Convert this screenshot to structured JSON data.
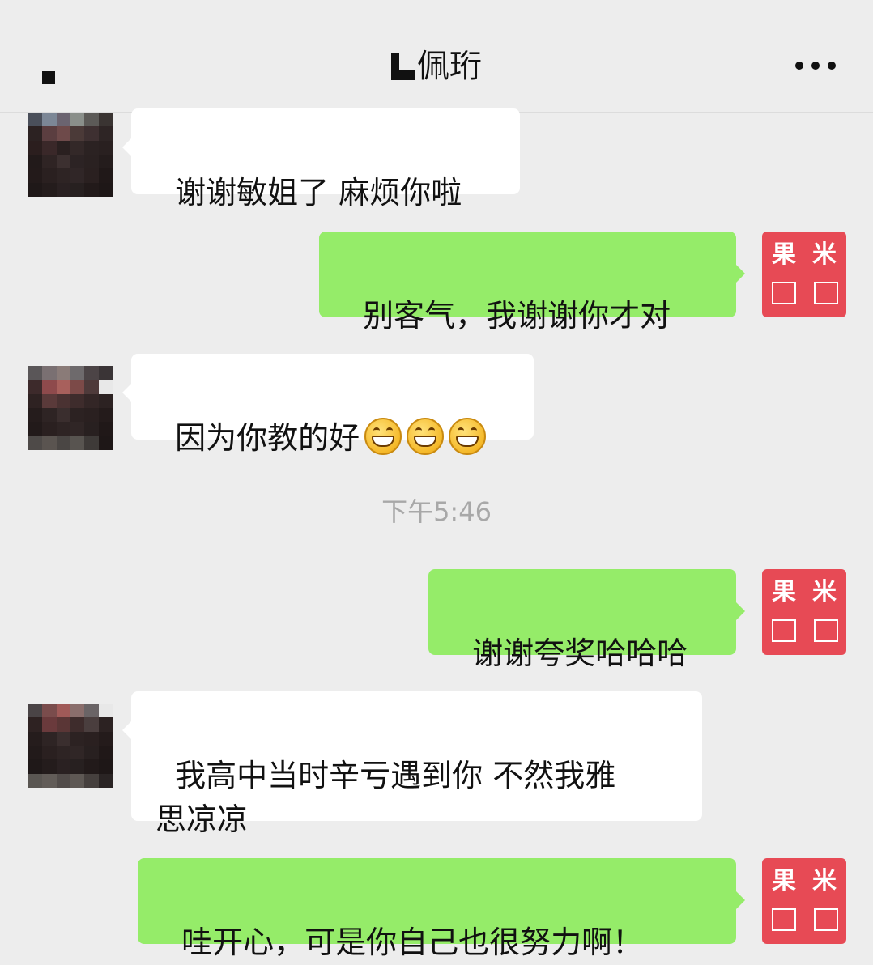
{
  "header": {
    "title": "佩珩",
    "back_icon": "back-icon",
    "more_icon": "more-dots-icon"
  },
  "colors": {
    "background": "#ededed",
    "incoming_bubble": "#ffffff",
    "outgoing_bubble": "#95ec69",
    "self_avatar": "#e74a55",
    "timestamp_text": "#a8a8a8"
  },
  "timestamp": "下午5:46",
  "self_avatar": {
    "glyph_top_left": "果",
    "glyph_top_right": "米"
  },
  "messages": [
    {
      "direction": "incoming",
      "text": "谢谢敏姐了 麻烦你啦"
    },
    {
      "direction": "outgoing",
      "text": "别客气，我谢谢你才对"
    },
    {
      "direction": "incoming",
      "text": "因为你教的好",
      "emoji": [
        "grin-emoji",
        "grin-emoji",
        "grin-emoji"
      ]
    },
    {
      "direction": "outgoing",
      "text": "谢谢夸奖哈哈哈"
    },
    {
      "direction": "incoming",
      "text": "我高中当时辛亏遇到你 不然我雅\n思凉凉"
    },
    {
      "direction": "outgoing",
      "text": "哇开心，可是你自己也很努力啊！"
    }
  ]
}
